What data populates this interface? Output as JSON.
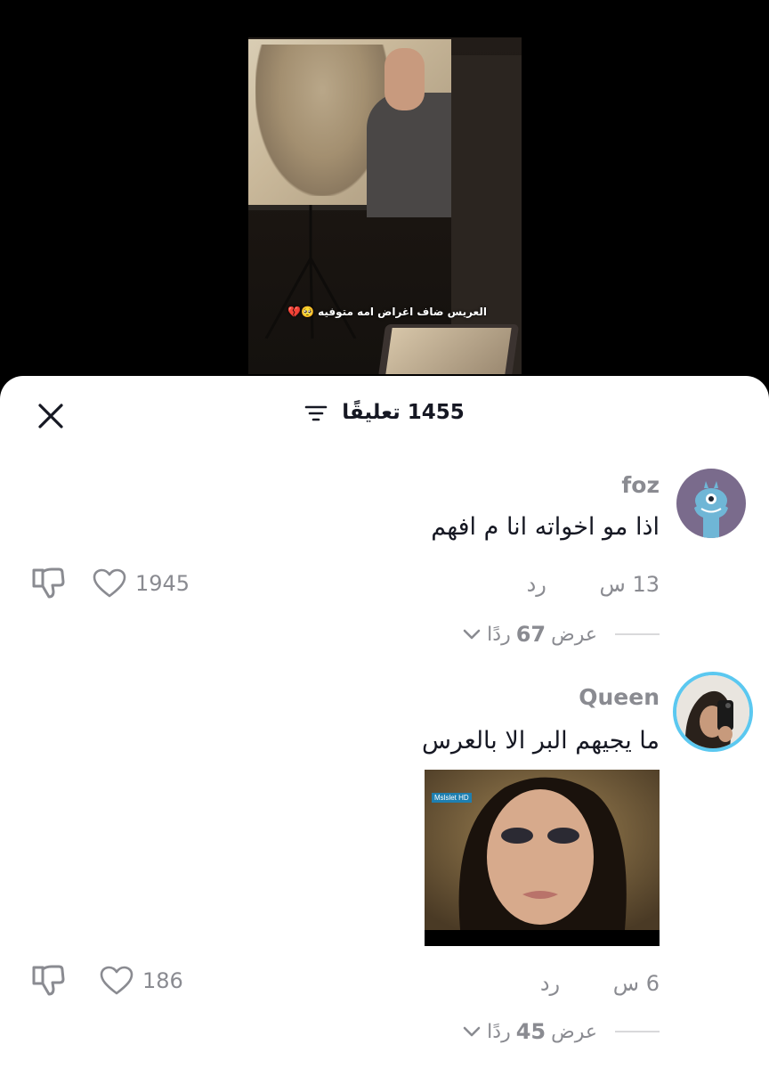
{
  "video": {
    "caption": "العريس ضاف اغراض امه متوفيه 🥺💔"
  },
  "header": {
    "count": "1455",
    "label": "تعليقًا"
  },
  "comments": [
    {
      "username": "foz",
      "text": "اذا مو اخواته انا م افهم",
      "time": "13 س",
      "reply_label": "رد",
      "likes": "1945",
      "view_replies_prefix": "عرض",
      "view_replies_count": "67",
      "view_replies_suffix": "ردًا"
    },
    {
      "username": "Queen",
      "text": "ما يجيهم البر الا بالعرس",
      "gif_badge": "Mslslet HD",
      "time": "6 س",
      "reply_label": "رد",
      "likes": "186",
      "view_replies_prefix": "عرض",
      "view_replies_count": "45",
      "view_replies_suffix": "ردًا"
    }
  ],
  "colors": {
    "background": "#000000",
    "sheet": "#ffffff",
    "text_primary": "#161823",
    "text_secondary": "#8a8b91",
    "avatar_foz_bg": "#7a6b8c",
    "avatar_queen_ring": "#5bc8f0"
  },
  "icons": {
    "close": "close-icon",
    "filter": "filter-icon",
    "heart": "heart-icon",
    "dislike": "thumbs-down-icon",
    "chevron": "chevron-down-icon"
  }
}
